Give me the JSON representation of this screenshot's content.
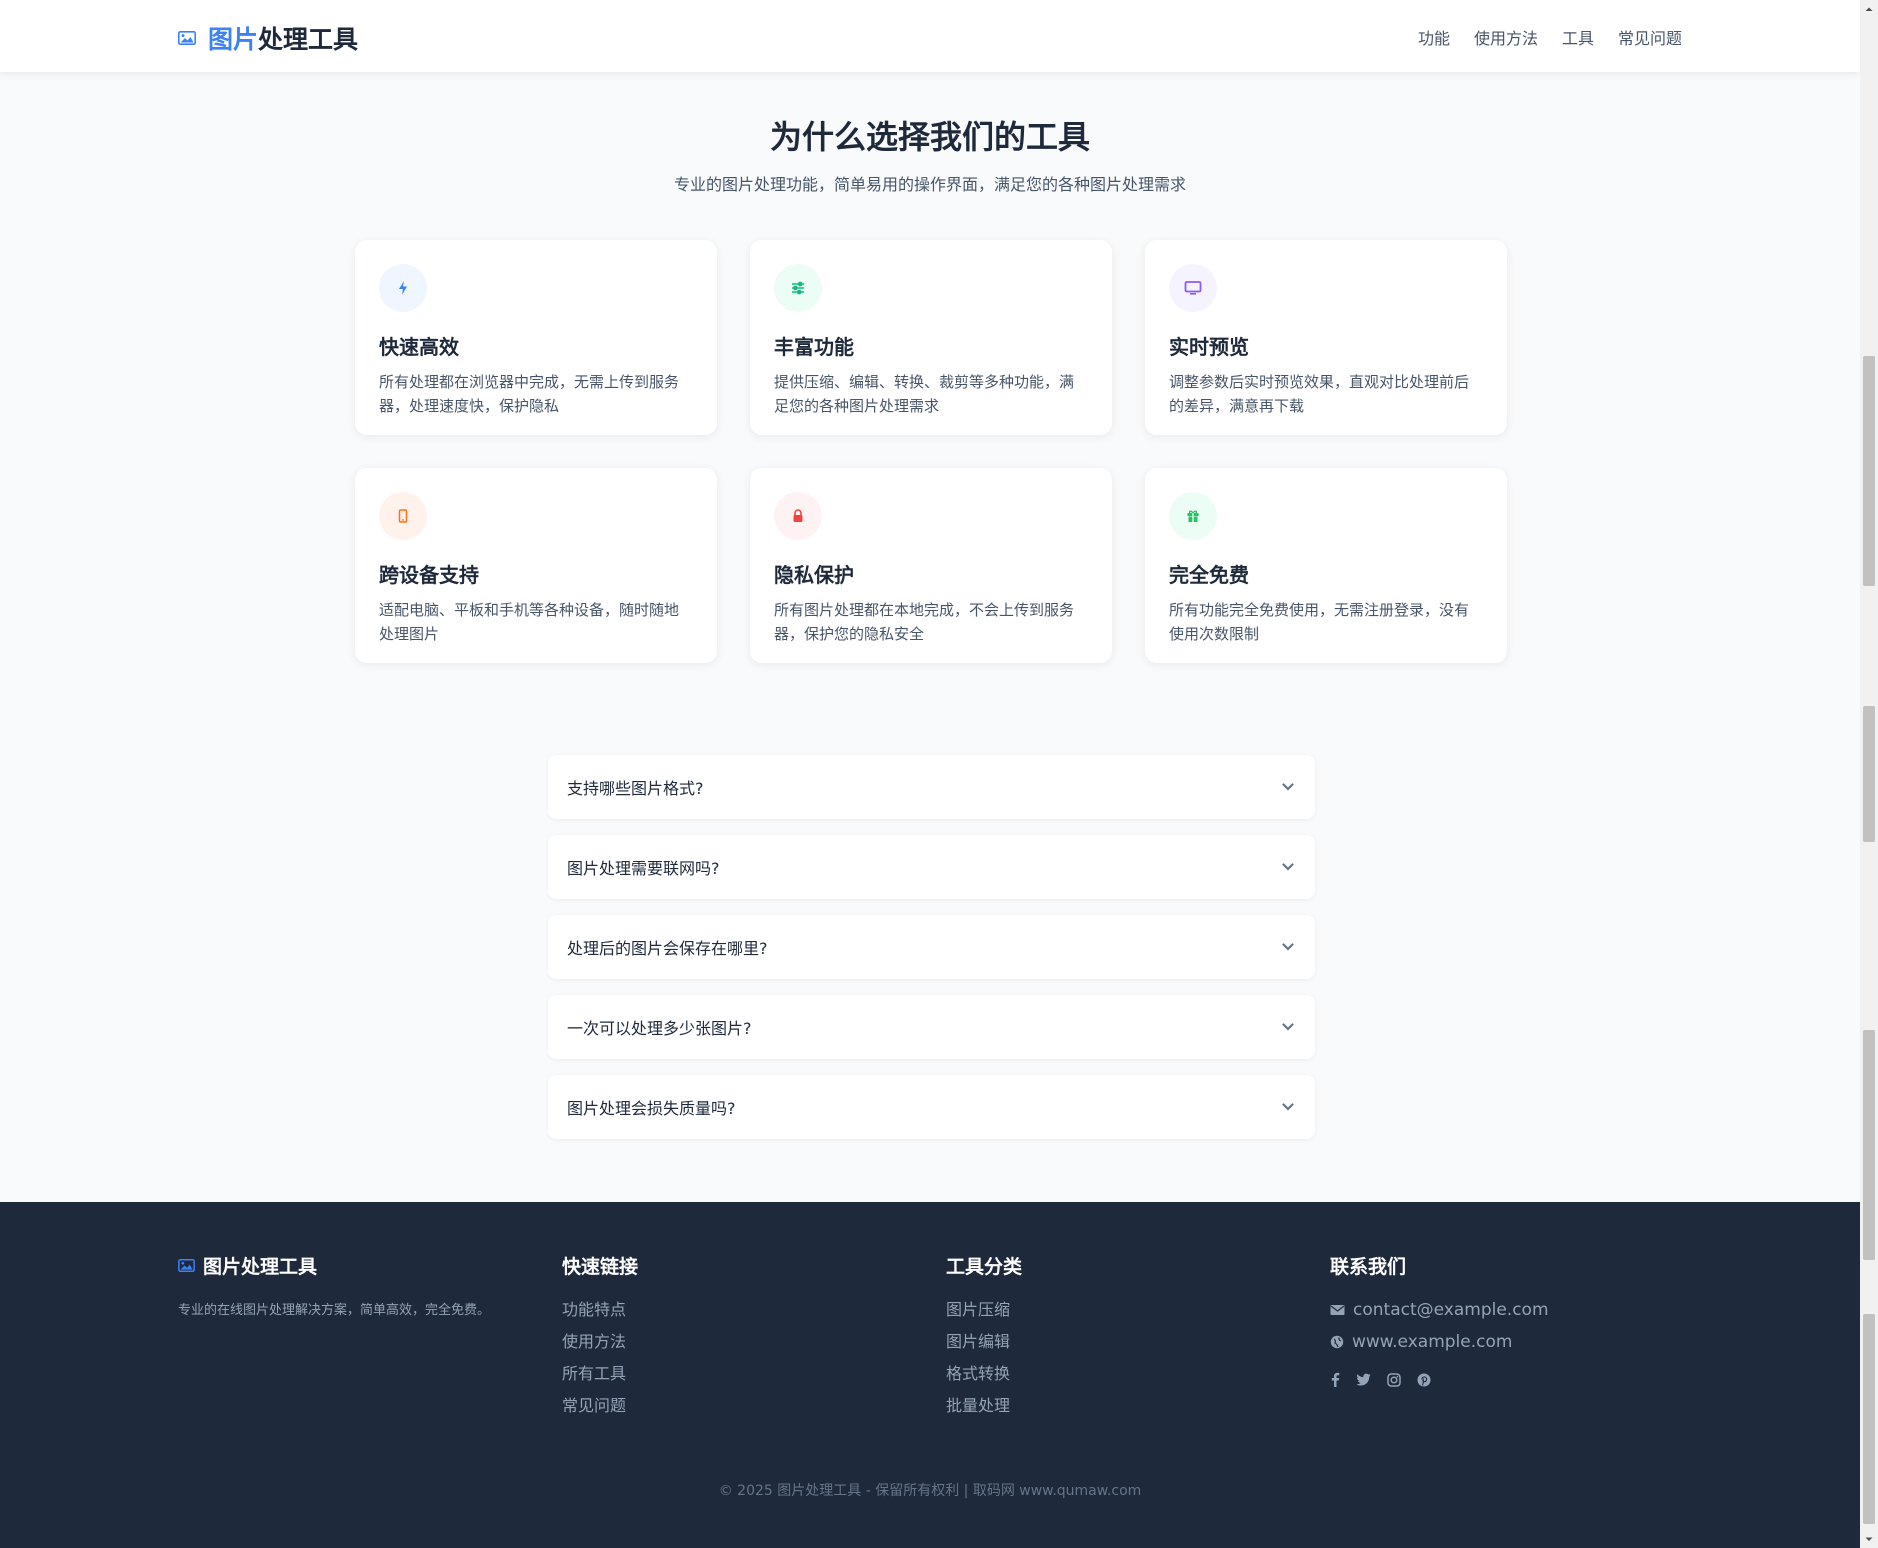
{
  "header": {
    "logo_accent": "图片",
    "logo_rest": "处理工具",
    "nav": [
      "功能",
      "使用方法",
      "工具",
      "常见问题"
    ]
  },
  "features": {
    "title": "为什么选择我们的工具",
    "subtitle": "专业的图片处理功能，简单易用的操作界面，满足您的各种图片处理需求",
    "cards": [
      {
        "icon": "bolt-icon",
        "title": "快速高效",
        "desc": "所有处理都在浏览器中完成，无需上传到服务器，处理速度快，保护隐私"
      },
      {
        "icon": "sliders-icon",
        "title": "丰富功能",
        "desc": "提供压缩、编辑、转换、裁剪等多种功能，满足您的各种图片处理需求"
      },
      {
        "icon": "monitor-icon",
        "title": "实时预览",
        "desc": "调整参数后实时预览效果，直观对比处理前后的差异，满意再下载"
      },
      {
        "icon": "mobile-icon",
        "title": "跨设备支持",
        "desc": "适配电脑、平板和手机等各种设备，随时随地处理图片"
      },
      {
        "icon": "lock-icon",
        "title": "隐私保护",
        "desc": "所有图片处理都在本地完成，不会上传到服务器，保护您的隐私安全"
      },
      {
        "icon": "gift-icon",
        "title": "完全免费",
        "desc": "所有功能完全免费使用，无需注册登录，没有使用次数限制"
      }
    ]
  },
  "faq": [
    "支持哪些图片格式?",
    "图片处理需要联网吗?",
    "处理后的图片会保存在哪里?",
    "一次可以处理多少张图片?",
    "图片处理会损失质量吗?"
  ],
  "footer": {
    "brand": "图片处理工具",
    "brand_desc": "专业的在线图片处理解决方案，简单高效，完全免费。",
    "quick_title": "快速链接",
    "quick_links": [
      "功能特点",
      "使用方法",
      "所有工具",
      "常见问题"
    ],
    "tools_title": "工具分类",
    "tools_links": [
      "图片压缩",
      "图片编辑",
      "格式转换",
      "批量处理"
    ],
    "contact_title": "联系我们",
    "email": "contact@example.com",
    "website": "www.example.com",
    "social": [
      "facebook-icon",
      "twitter-icon",
      "instagram-icon",
      "pinterest-icon"
    ],
    "copyright": "© 2025 图片处理工具 - 保留所有权利 | 取码网 www.qumaw.com"
  },
  "colors": {
    "accent": "#3b82f6",
    "footer_bg": "#1e293b",
    "page_bg": "#f8fafc"
  }
}
